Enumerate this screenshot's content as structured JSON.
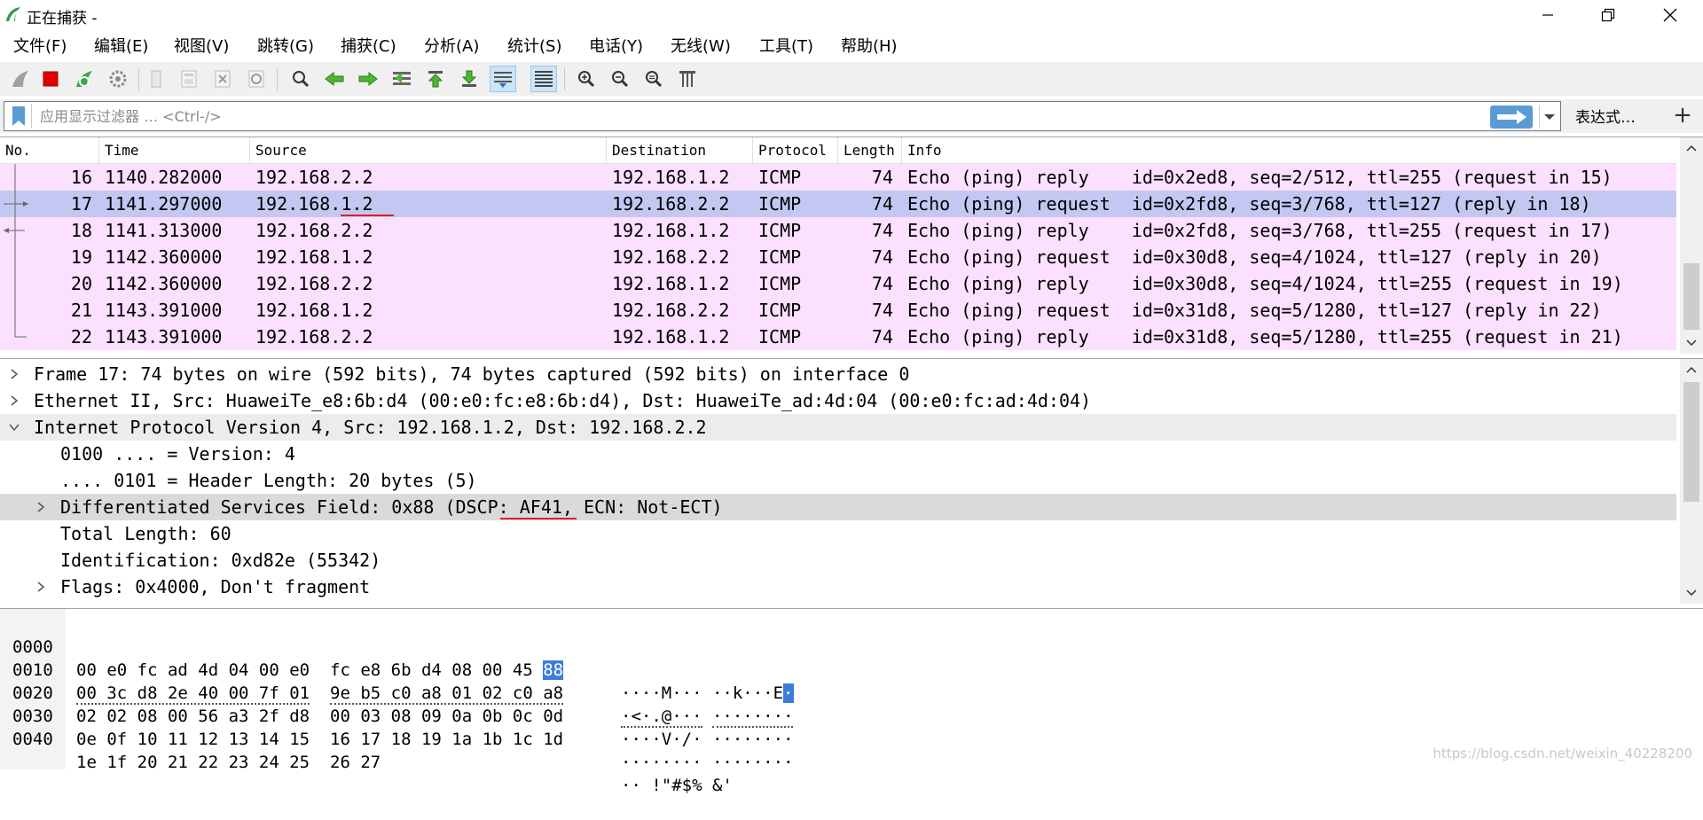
{
  "window": {
    "title": "正在捕获 -"
  },
  "menu": [
    "文件(F)",
    "编辑(E)",
    "视图(V)",
    "跳转(G)",
    "捕获(C)",
    "分析(A)",
    "统计(S)",
    "电话(Y)",
    "无线(W)",
    "工具(T)",
    "帮助(H)"
  ],
  "filter": {
    "placeholder": "应用显示过滤器 … <Ctrl-/>",
    "expression_label": "表达式…",
    "plus_label": "+"
  },
  "packet_list": {
    "columns": [
      "No.",
      "Time",
      "Source",
      "Destination",
      "Protocol",
      "Length",
      "Info"
    ],
    "rows": [
      {
        "no": "16",
        "time": "1140.282000",
        "src": "192.168.2.2",
        "dst": "192.168.1.2",
        "proto": "ICMP",
        "len": "74",
        "info": "Echo (ping) reply    id=0x2ed8, seq=2/512, ttl=255 (request in 15)"
      },
      {
        "no": "17",
        "time": "1141.297000",
        "src": "192.168.1.2",
        "dst": "192.168.2.2",
        "proto": "ICMP",
        "len": "74",
        "info": "Echo (ping) request  id=0x2fd8, seq=3/768, ttl=127 (reply in 18)"
      },
      {
        "no": "18",
        "time": "1141.313000",
        "src": "192.168.2.2",
        "dst": "192.168.1.2",
        "proto": "ICMP",
        "len": "74",
        "info": "Echo (ping) reply    id=0x2fd8, seq=3/768, ttl=255 (request in 17)"
      },
      {
        "no": "19",
        "time": "1142.360000",
        "src": "192.168.1.2",
        "dst": "192.168.2.2",
        "proto": "ICMP",
        "len": "74",
        "info": "Echo (ping) request  id=0x30d8, seq=4/1024, ttl=127 (reply in 20)"
      },
      {
        "no": "20",
        "time": "1142.360000",
        "src": "192.168.2.2",
        "dst": "192.168.1.2",
        "proto": "ICMP",
        "len": "74",
        "info": "Echo (ping) reply    id=0x30d8, seq=4/1024, ttl=255 (request in 19)"
      },
      {
        "no": "21",
        "time": "1143.391000",
        "src": "192.168.1.2",
        "dst": "192.168.2.2",
        "proto": "ICMP",
        "len": "74",
        "info": "Echo (ping) request  id=0x31d8, seq=5/1280, ttl=127 (reply in 22)"
      },
      {
        "no": "22",
        "time": "1143.391000",
        "src": "192.168.2.2",
        "dst": "192.168.1.2",
        "proto": "ICMP",
        "len": "74",
        "info": "Echo (ping) reply    id=0x31d8, seq=5/1280, ttl=255 (request in 21)"
      }
    ]
  },
  "details": [
    {
      "text": "Frame 17: 74 bytes on wire (592 bits), 74 bytes captured (592 bits) on interface 0",
      "arrow": "collapsed"
    },
    {
      "text": "Ethernet II, Src: HuaweiTe_e8:6b:d4 (00:e0:fc:e8:6b:d4), Dst: HuaweiTe_ad:4d:04 (00:e0:fc:ad:4d:04)",
      "arrow": "collapsed"
    },
    {
      "text": "Internet Protocol Version 4, Src: 192.168.1.2, Dst: 192.168.2.2",
      "arrow": "expanded"
    },
    {
      "text": "0100 .... = Version: 4",
      "arrow": "none"
    },
    {
      "text": ".... 0101 = Header Length: 20 bytes (5)",
      "arrow": "none"
    },
    {
      "text": "Differentiated Services Field: 0x88 (DSCP: AF41, ECN: Not-ECT)",
      "arrow": "collapsed"
    },
    {
      "text": "Total Length: 60",
      "arrow": "none"
    },
    {
      "text": "Identification: 0xd82e (55342)",
      "arrow": "none"
    },
    {
      "text": "Flags: 0x4000, Don't fragment",
      "arrow": "collapsed"
    }
  ],
  "bytes": [
    {
      "offset": "0000",
      "hex_a": "00 e0 fc ad 4d 04 00 e0",
      "hex_b": "fc e8 6b d4 08 00 45",
      "hex_hl": "88",
      "ascii_a": "····M···",
      "ascii_b": "··k···E",
      "ascii_hl": "·"
    },
    {
      "offset": "0010",
      "hex_a": "00 3c d8 2e 40 00 7f 01",
      "hex_b": "9e b5 c0 a8 01 02 c0 a8",
      "hex_hl": "",
      "ascii_a": "·<·.@···",
      "ascii_b": "········",
      "ascii_hl": ""
    },
    {
      "offset": "0020",
      "hex_a": "02 02 08 00 56 a3 2f d8",
      "hex_b": "00 03 08 09 0a 0b 0c 0d",
      "hex_hl": "",
      "ascii_a": "····V·/·",
      "ascii_b": "········",
      "ascii_hl": ""
    },
    {
      "offset": "0030",
      "hex_a": "0e 0f 10 11 12 13 14 15",
      "hex_b": "16 17 18 19 1a 1b 1c 1d",
      "hex_hl": "",
      "ascii_a": "········",
      "ascii_b": "········",
      "ascii_hl": ""
    },
    {
      "offset": "0040",
      "hex_a": "1e 1f 20 21 22 23 24 25",
      "hex_b": "26 27",
      "hex_hl": "",
      "ascii_a": "·· !\"#$%",
      "ascii_b": "&'",
      "ascii_hl": ""
    }
  ],
  "watermark": "https://blog.csdn.net/weixin_40228200",
  "colors": {
    "row_pink": "#fce0ff",
    "row_selected": "#c2c8f2",
    "annotation_red": "#e02020",
    "byte_highlight": "#3b7dd8"
  }
}
